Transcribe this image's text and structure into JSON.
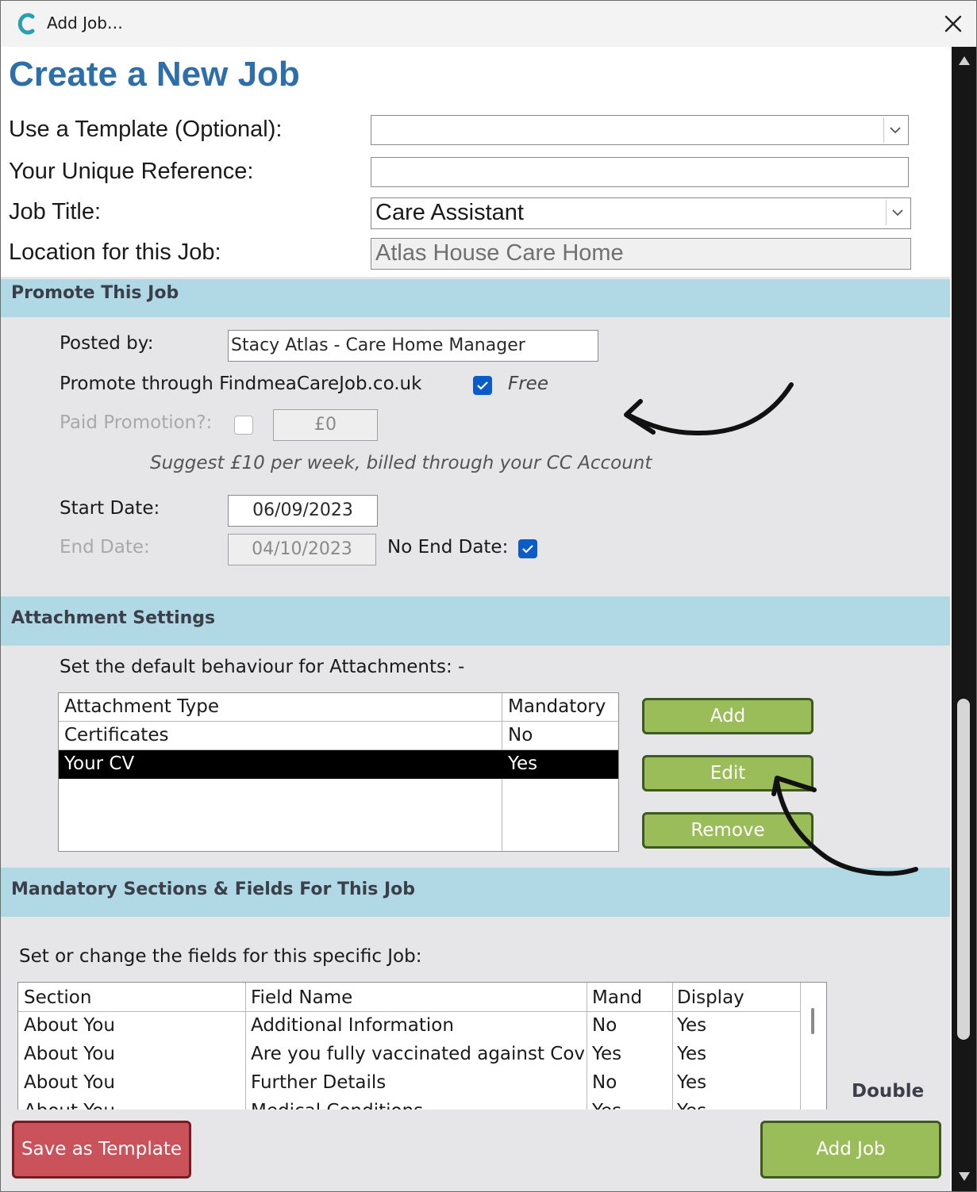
{
  "window": {
    "title": "Add Job…"
  },
  "heading": "Create a New Job",
  "form": {
    "template_label": "Use a Template (Optional):",
    "template_value": "",
    "reference_label": "Your Unique Reference:",
    "reference_value": "",
    "job_title_label": "Job Title:",
    "job_title_value": "Care Assistant",
    "location_label": "Location for this Job:",
    "location_value": "Atlas House Care Home"
  },
  "promote": {
    "section_title": "Promote This Job",
    "posted_by_label": "Posted by:",
    "posted_by_value": "Stacy Atlas - Care Home Manager",
    "promote_through_label": "Promote through FindmeaCareJob.co.uk",
    "promote_checked": true,
    "free_label": "Free",
    "paid_label": "Paid Promotion?:",
    "paid_checked": false,
    "paid_amount": "£0",
    "suggest_text": "Suggest £10 per week, billed through your CC Account",
    "start_date_label": "Start Date:",
    "start_date_value": "06/09/2023",
    "end_date_label": "End Date:",
    "end_date_value": "04/10/2023",
    "no_end_date_label": "No End Date:",
    "no_end_date_checked": true
  },
  "attachments": {
    "section_title": "Attachment Settings",
    "instruction": "Set the default behaviour for Attachments: -",
    "columns": [
      "Attachment Type",
      "Mandatory"
    ],
    "rows": [
      {
        "type": "Certificates",
        "mandatory": "No",
        "selected": false
      },
      {
        "type": "Your CV",
        "mandatory": "Yes",
        "selected": true
      }
    ],
    "add_label": "Add",
    "edit_label": "Edit",
    "remove_label": "Remove"
  },
  "mandatory": {
    "section_title": "Mandatory Sections & Fields For This Job",
    "instruction": "Set or change the fields for this specific Job:",
    "columns": [
      "Section",
      "Field Name",
      "Mand",
      "Display"
    ],
    "rows": [
      {
        "section": "About You",
        "field": "Additional Information",
        "mand": "No",
        "display": "Yes"
      },
      {
        "section": "About You",
        "field": "Are you fully vaccinated against Cov",
        "mand": "Yes",
        "display": "Yes"
      },
      {
        "section": "About You",
        "field": "Further Details",
        "mand": "No",
        "display": "Yes"
      },
      {
        "section": "About You",
        "field": "Medical Conditions",
        "mand": "Yes",
        "display": "Yes"
      }
    ],
    "side_label": "Double"
  },
  "footer": {
    "save_template_label": "Save as Template",
    "add_job_label": "Add Job"
  },
  "colors": {
    "heading": "#2e6fa9",
    "band": "#b0d9e5",
    "green_button": "#9bbd59",
    "red_button": "#c9525b",
    "checkbox": "#0b5cc9"
  }
}
